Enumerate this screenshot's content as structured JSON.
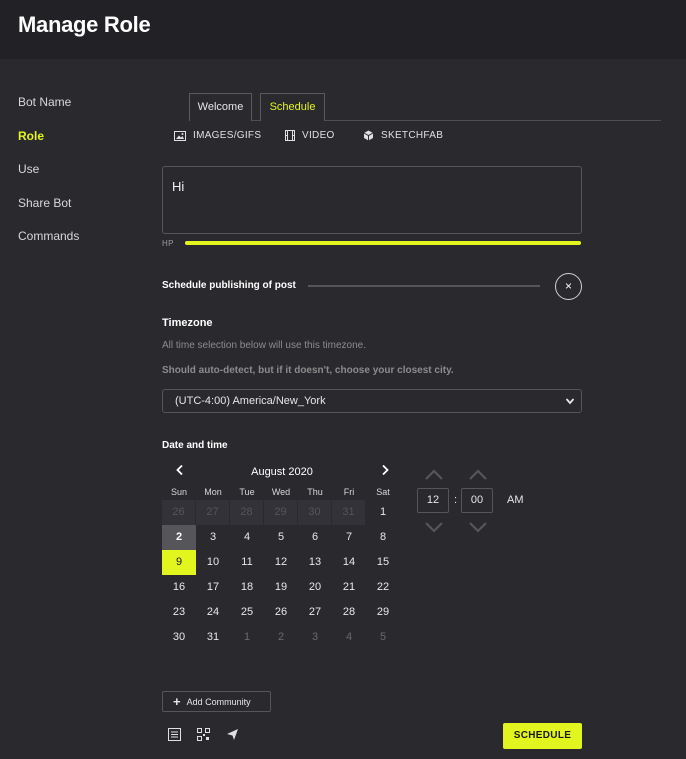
{
  "header": {
    "title": "Manage Role"
  },
  "sidebar": {
    "items": [
      {
        "label": "Bot Name",
        "active": false
      },
      {
        "label": "Role",
        "active": true
      },
      {
        "label": "Use",
        "active": false
      },
      {
        "label": "Share Bot",
        "active": false
      },
      {
        "label": "Commands",
        "active": false
      }
    ]
  },
  "tabs": [
    {
      "label": "Welcome",
      "active": false
    },
    {
      "label": "Schedule",
      "active": true
    }
  ],
  "media": {
    "images_label": "IMAGES/GIFS",
    "video_label": "VIDEO",
    "sketchfab_label": "SKETCHFAB"
  },
  "editor": {
    "value": "Hi"
  },
  "hp": {
    "label": "HP",
    "fill_percent": 100
  },
  "schedule_toggle": {
    "label": "Schedule publishing of post",
    "close_glyph": "×"
  },
  "timezone": {
    "title": "Timezone",
    "help_1": "All time selection below will use this timezone.",
    "help_2": "Should auto-detect, but if it doesn't, choose your closest city.",
    "selected": "(UTC-4:00) America/New_York"
  },
  "datetime": {
    "title": "Date and time",
    "calendar": {
      "month_label": "August 2020",
      "prev_glyph": "‹",
      "next_glyph": "›",
      "weekdays": [
        "Sun",
        "Mon",
        "Tue",
        "Wed",
        "Thu",
        "Fri",
        "Sat"
      ],
      "weeks": [
        [
          "26",
          "27",
          "28",
          "29",
          "30",
          "31",
          "1"
        ],
        [
          "2",
          "3",
          "4",
          "5",
          "6",
          "7",
          "8"
        ],
        [
          "9",
          "10",
          "11",
          "12",
          "13",
          "14",
          "15"
        ],
        [
          "16",
          "17",
          "18",
          "19",
          "20",
          "21",
          "22"
        ],
        [
          "23",
          "24",
          "25",
          "26",
          "27",
          "28",
          "29"
        ],
        [
          "30",
          "31",
          "1",
          "2",
          "3",
          "4",
          "5"
        ]
      ],
      "today": "2",
      "selected": "9"
    },
    "time": {
      "hour": "12",
      "separator": ":",
      "minute": "00",
      "ampm": "AM"
    }
  },
  "footer": {
    "add_community_label": "Add Community",
    "add_glyph": "+",
    "schedule_label": "SCHEDULE"
  },
  "colors": {
    "accent": "#e2f51f",
    "background": "#2a292e",
    "header": "#222126"
  }
}
